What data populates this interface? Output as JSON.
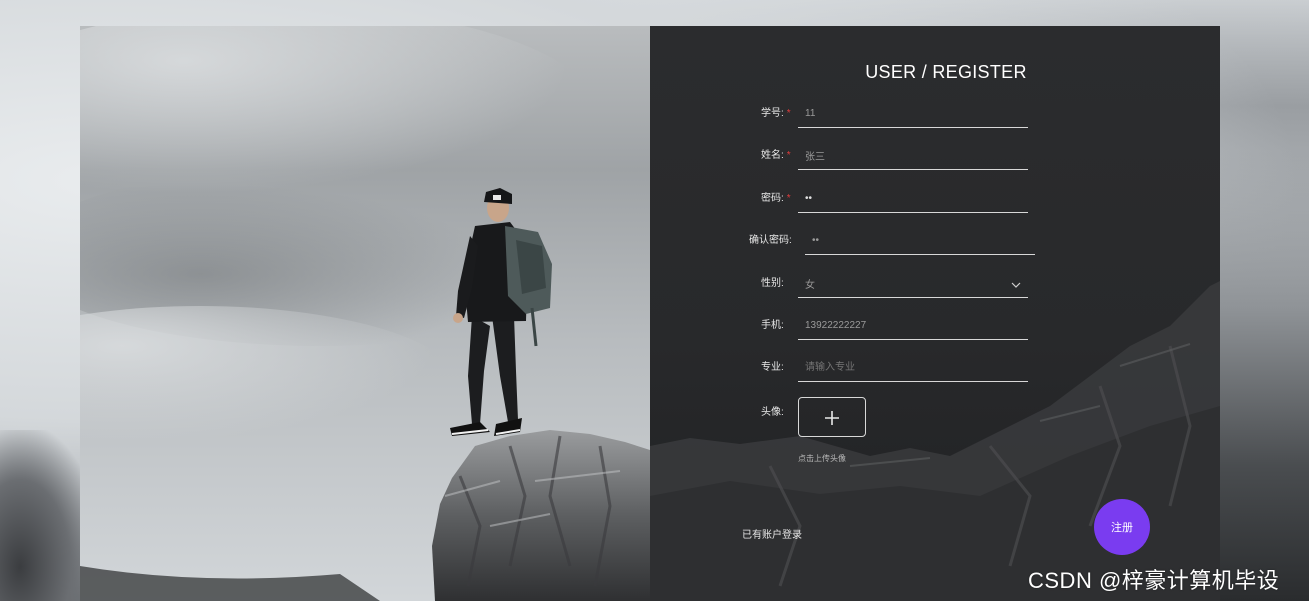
{
  "colors": {
    "accent": "#7a3cf0",
    "required_star": "#e23b3b",
    "panel_bg": "#2a2b2d"
  },
  "form": {
    "title": "USER / REGISTER",
    "required_mark": "*",
    "fields": [
      {
        "label": "学号:",
        "value": "11",
        "required": true
      },
      {
        "label": "姓名:",
        "value": "张三",
        "required": true
      },
      {
        "label": "密码:",
        "value": "••",
        "required": true
      },
      {
        "label": "确认密码:",
        "value": "••",
        "required": false
      },
      {
        "label": "性别:",
        "value": "女",
        "required": false,
        "icon": "chevron-down-icon"
      },
      {
        "label": "手机:",
        "value": "13922222227",
        "required": false
      },
      {
        "label": "专业:",
        "placeholder": "请输入专业",
        "required": false
      }
    ],
    "avatar": {
      "label": "头像:",
      "icon": "plus-icon",
      "hint": "点击上传头像"
    },
    "login_link": "已有账户登录",
    "register_button": "注册"
  },
  "watermark": "CSDN @梓豪计算机毕设"
}
